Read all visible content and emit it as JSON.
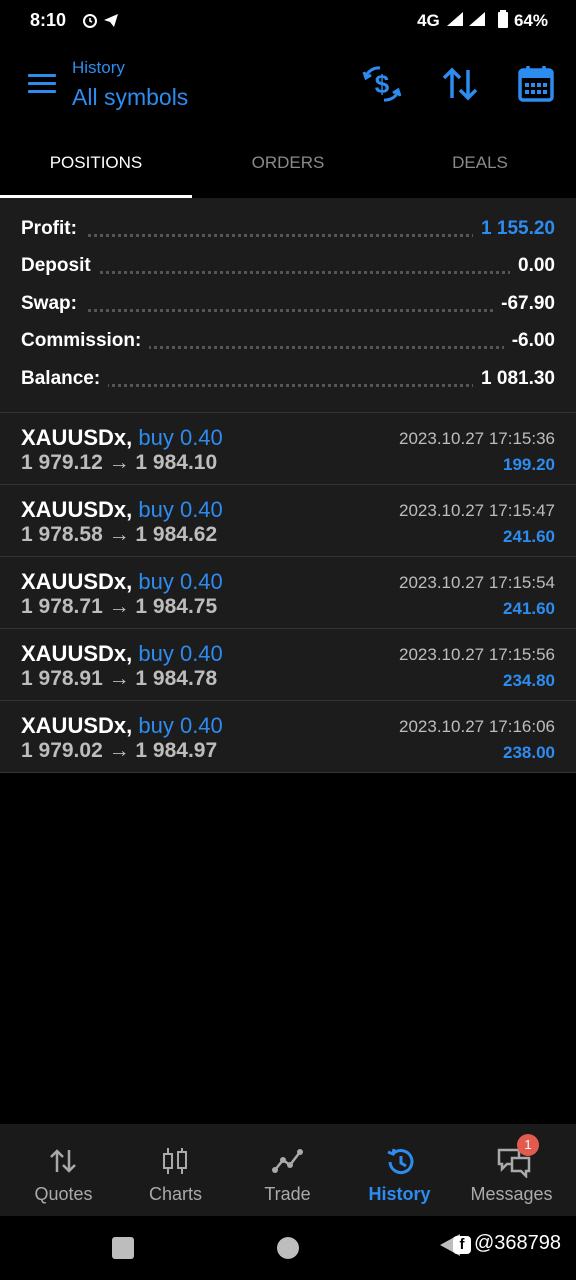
{
  "status_bar": {
    "time": "8:10",
    "network": "4G",
    "battery": "64%"
  },
  "header": {
    "title": "History",
    "subtitle": "All symbols"
  },
  "tabs": [
    {
      "label": "POSITIONS",
      "active": true
    },
    {
      "label": "ORDERS",
      "active": false
    },
    {
      "label": "DEALS",
      "active": false
    }
  ],
  "summary": [
    {
      "label": "Profit:",
      "value": "1 155.20",
      "highlight": true
    },
    {
      "label": "Deposit",
      "value": "0.00",
      "highlight": false
    },
    {
      "label": "Swap:",
      "value": "-67.90",
      "highlight": false
    },
    {
      "label": "Commission:",
      "value": "-6.00",
      "highlight": false
    },
    {
      "label": "Balance:",
      "value": "1 081.30",
      "highlight": false
    }
  ],
  "positions": [
    {
      "symbol": "XAUUSDx,",
      "type": "buy 0.40",
      "open": "1 979.12",
      "close": "1 984.10",
      "datetime": "2023.10.27 17:15:36",
      "profit": "199.20"
    },
    {
      "symbol": "XAUUSDx,",
      "type": "buy 0.40",
      "open": "1 978.58",
      "close": "1 984.62",
      "datetime": "2023.10.27 17:15:47",
      "profit": "241.60"
    },
    {
      "symbol": "XAUUSDx,",
      "type": "buy 0.40",
      "open": "1 978.71",
      "close": "1 984.75",
      "datetime": "2023.10.27 17:15:54",
      "profit": "241.60"
    },
    {
      "symbol": "XAUUSDx,",
      "type": "buy 0.40",
      "open": "1 978.91",
      "close": "1 984.78",
      "datetime": "2023.10.27 17:15:56",
      "profit": "234.80"
    },
    {
      "symbol": "XAUUSDx,",
      "type": "buy 0.40",
      "open": "1 979.02",
      "close": "1 984.97",
      "datetime": "2023.10.27 17:16:06",
      "profit": "238.00"
    }
  ],
  "bottom_nav": [
    {
      "label": "Quotes",
      "icon": "quotes-arrows-icon",
      "active": false
    },
    {
      "label": "Charts",
      "icon": "candlestick-icon",
      "active": false
    },
    {
      "label": "Trade",
      "icon": "trend-line-icon",
      "active": false
    },
    {
      "label": "History",
      "icon": "history-clock-icon",
      "active": true
    },
    {
      "label": "Messages",
      "icon": "chat-bubbles-icon",
      "active": false,
      "badge": "1"
    }
  ],
  "watermark": "@368798",
  "colors": {
    "accent": "#2d8cf0",
    "background": "#000000",
    "panel": "#1c1c1c",
    "badge": "#e35a4f"
  }
}
